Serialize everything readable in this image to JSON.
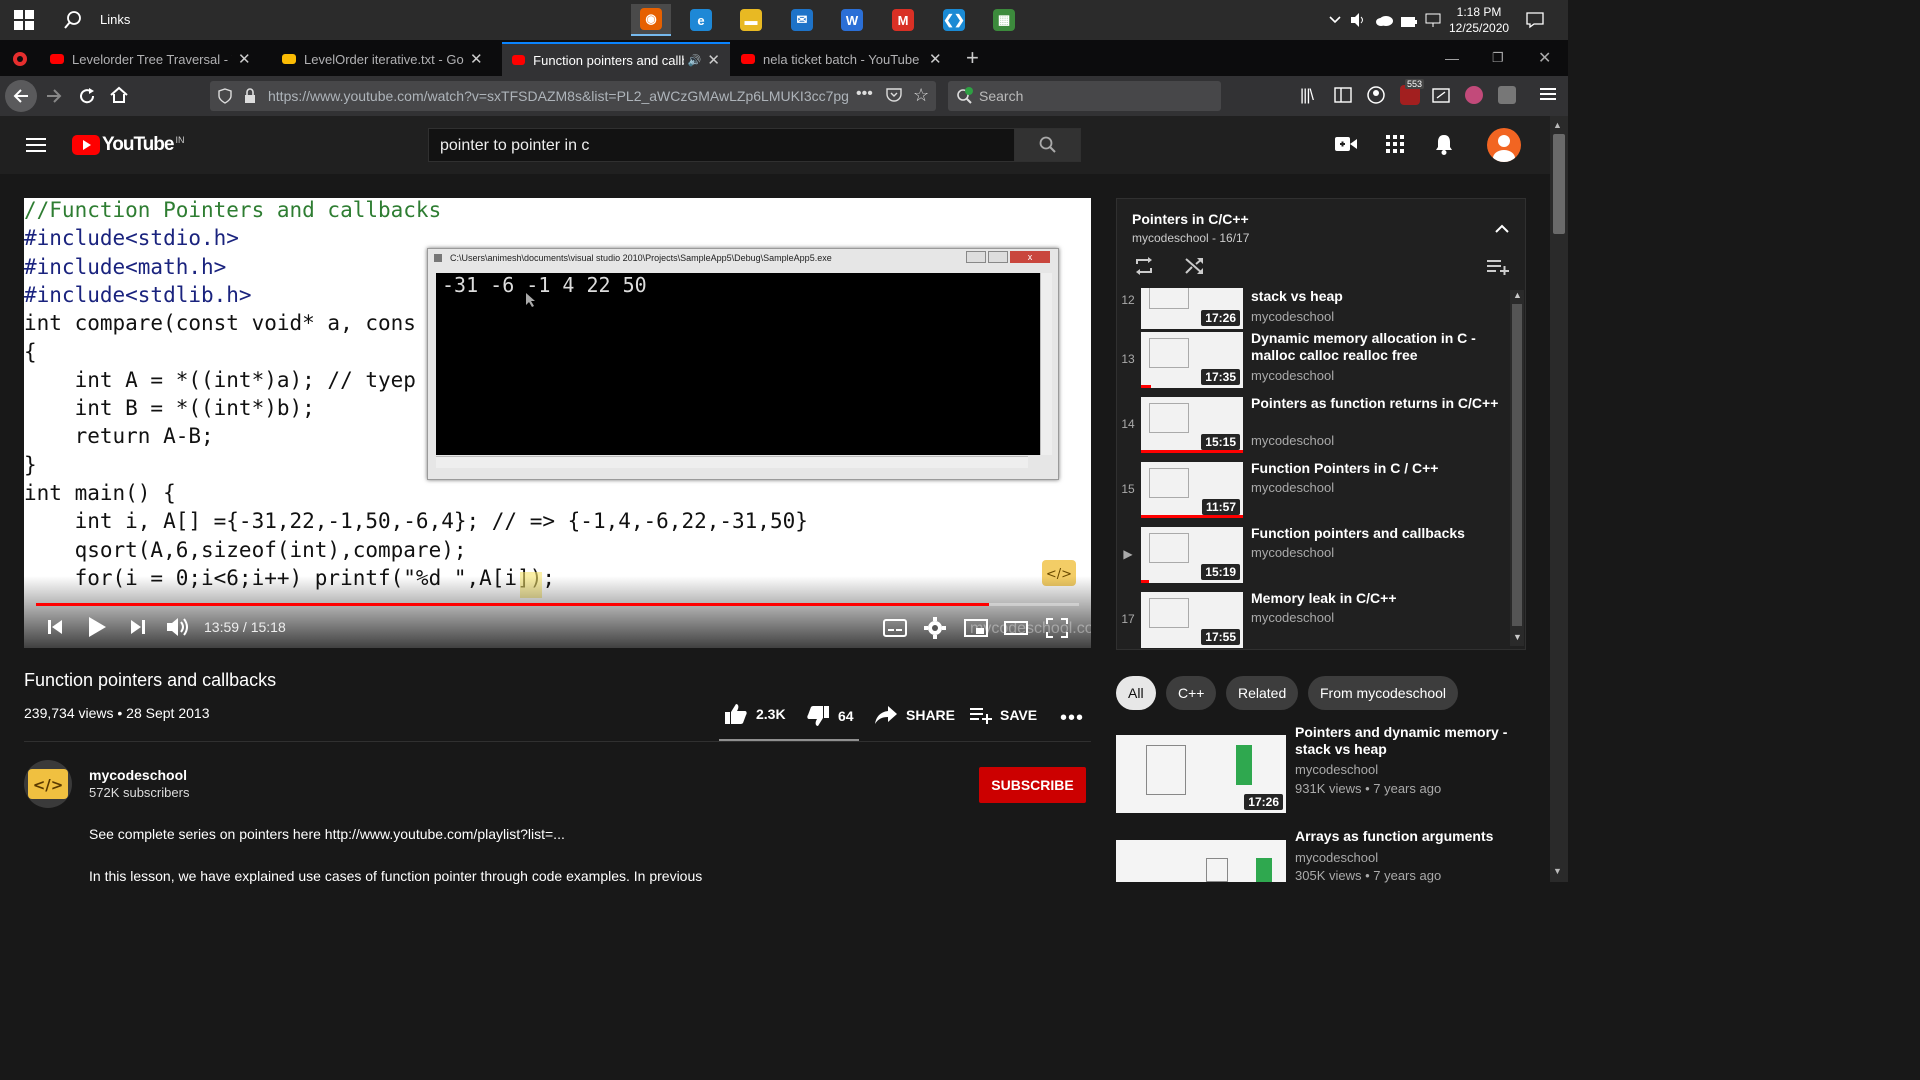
{
  "taskbar": {
    "search_label": "Links",
    "time": "1:18 PM",
    "date": "12/25/2020",
    "apps": [
      {
        "name": "firefox",
        "color": "#e66000",
        "glyph": "◉",
        "active": true
      },
      {
        "name": "edge",
        "color": "#1e88d6",
        "glyph": "e",
        "active": false
      },
      {
        "name": "file-explorer",
        "color": "#e8b923",
        "glyph": "▬",
        "active": false
      },
      {
        "name": "mail",
        "color": "#1e73c8",
        "glyph": "✉",
        "active": false
      },
      {
        "name": "word",
        "color": "#2b6fd6",
        "glyph": "W",
        "active": false
      },
      {
        "name": "gmail-m",
        "color": "#d93025",
        "glyph": "M",
        "active": false
      },
      {
        "name": "vscode",
        "color": "#1a8ad4",
        "glyph": "❮❯",
        "active": false
      },
      {
        "name": "sheet-app",
        "color": "#3c8a3c",
        "glyph": "▦",
        "active": false
      }
    ]
  },
  "browser": {
    "tabs": [
      {
        "title": "Levelorder Tree Traversal - You",
        "favicon": "youtube",
        "active": false
      },
      {
        "title": "LevelOrder iterative.txt - Goog",
        "favicon": "drive",
        "active": false
      },
      {
        "title": "Function pointers and callba",
        "favicon": "youtube",
        "active": true
      },
      {
        "title": "nela ticket batch - YouTube",
        "favicon": "youtube",
        "active": false
      }
    ],
    "url": "https://www.youtube.com/watch?v=sxTFSDAZM8s&list=PL2_aWCzGMAwLZp6LMUKI3cc7pg",
    "search_placeholder": "Search",
    "badge_count": "553"
  },
  "youtube": {
    "logo_text": "YouTube",
    "region": "IN",
    "search_value": "pointer to pointer in c"
  },
  "video": {
    "code_lines": [
      {
        "text": "//Function Pointers and callbacks",
        "color": "#2e7d32"
      },
      {
        "text": "#include<stdio.h>",
        "color": "#1a237e"
      },
      {
        "text": "#include<math.h>",
        "color": "#1a237e"
      },
      {
        "text": "#include<stdlib.h>",
        "color": "#1a237e"
      },
      {
        "text": "int compare(const void* a, cons",
        "color": "#111"
      },
      {
        "text": "{",
        "color": "#111"
      },
      {
        "text": "    int A = *((int*)a); // tyep",
        "color": "#111"
      },
      {
        "text": "    int B = *((int*)b);",
        "color": "#111"
      },
      {
        "text": "    return A-B;",
        "color": "#111"
      },
      {
        "text": "}",
        "color": "#111"
      },
      {
        "text": "int main() {",
        "color": "#111"
      },
      {
        "text": "    int i, A[] ={-31,22,-1,50,-6,4}; // => {-1,4,-6,22,-31,50}",
        "color": "#111"
      },
      {
        "text": "    qsort(A,6,sizeof(int),compare);",
        "color": "#111"
      },
      {
        "text": "    for(i = 0;i<6;i++) printf(\"%d \",A[i]);",
        "color": "#111"
      }
    ],
    "console_title": "C:\\Users\\animesh\\documents\\visual studio 2010\\Projects\\SampleApp5\\Debug\\SampleApp5.exe",
    "console_output": "-31 -6 -1 4 22 50",
    "watermark": "mycodeschool.com",
    "time_display": "13:59 / 15:18",
    "progress_fraction": 0.914,
    "title": "Function pointers and callbacks",
    "views_date": "239,734 views • 28 Sept 2013",
    "likes": "2.3K",
    "dislikes": "64",
    "share_label": "SHARE",
    "save_label": "SAVE"
  },
  "channel": {
    "name": "mycodeschool",
    "subscribers": "572K subscribers",
    "subscribe_label": "SUBSCRIBE",
    "description_line1": "See complete series on pointers here http://www.youtube.com/playlist?list=...",
    "description_line2": "In this lesson, we have explained use cases of function pointer through code examples. In previous"
  },
  "playlist": {
    "title": "Pointers in C/C++",
    "subtitle": "mycodeschool - 16/17",
    "items": [
      {
        "index": "12",
        "title": "Pointers and dynamic memory - stack vs heap",
        "channel": "mycodeschool",
        "duration": "17:26",
        "watched": 0.0
      },
      {
        "index": "13",
        "title": "Dynamic memory allocation in C - malloc calloc realloc free",
        "channel": "mycodeschool",
        "duration": "17:35",
        "watched": 0.1
      },
      {
        "index": "14",
        "title": "Pointers as function returns in C/C++",
        "channel": "mycodeschool",
        "duration": "15:15",
        "watched": 1.0
      },
      {
        "index": "15",
        "title": "Function Pointers in C / C++",
        "channel": "mycodeschool",
        "duration": "11:57",
        "watched": 1.0
      },
      {
        "index": "▶",
        "title": "Function pointers and callbacks",
        "channel": "mycodeschool",
        "duration": "15:19",
        "watched": 0.08
      },
      {
        "index": "17",
        "title": "Memory leak in C/C++",
        "channel": "mycodeschool",
        "duration": "17:55",
        "watched": 0.0
      }
    ]
  },
  "filters": [
    "All",
    "C++",
    "Related",
    "From mycodeschool"
  ],
  "recommendations": [
    {
      "title": "Pointers and dynamic memory - stack vs heap",
      "channel": "mycodeschool",
      "meta": "931K views • 7 years ago",
      "duration": "17:26"
    },
    {
      "title": "Arrays as function arguments",
      "channel": "mycodeschool",
      "meta": "305K views • 7 years ago",
      "duration": ""
    }
  ]
}
